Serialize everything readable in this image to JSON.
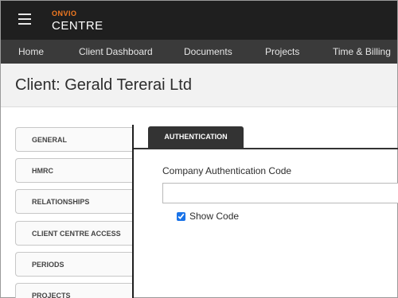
{
  "app": {
    "brand_top": "ONVIO",
    "brand_main": "CENTRE"
  },
  "nav": {
    "items": [
      {
        "label": "Home"
      },
      {
        "label": "Client Dashboard"
      },
      {
        "label": "Documents"
      },
      {
        "label": "Projects"
      },
      {
        "label": "Time & Billing"
      }
    ]
  },
  "page": {
    "title": "Client: Gerald Tererai Ltd"
  },
  "sidebar": {
    "items": [
      {
        "label": "GENERAL"
      },
      {
        "label": "HMRC"
      },
      {
        "label": "RELATIONSHIPS"
      },
      {
        "label": "CLIENT CENTRE ACCESS"
      },
      {
        "label": "PERIODS"
      },
      {
        "label": "PROJECTS"
      }
    ]
  },
  "tabs": {
    "active": "AUTHENTICATION"
  },
  "form": {
    "auth_code_label": "Company Authentication Code",
    "auth_code_value": "",
    "show_code_label": "Show Code",
    "show_code_checked": true
  },
  "colors": {
    "brand_accent": "#f47a20",
    "topbar_bg": "#1f1f1f",
    "navbar_bg": "#3a3a3a",
    "tab_bg": "#333333"
  }
}
